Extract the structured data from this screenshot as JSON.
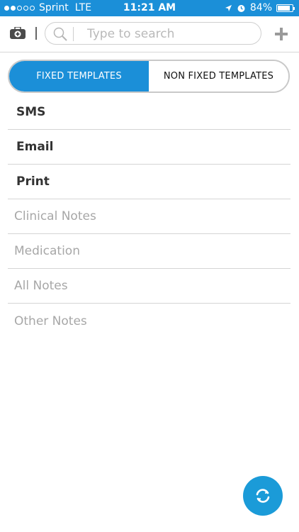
{
  "status_bar": {
    "carrier": "Sprint",
    "network": "LTE",
    "time": "11:21 AM",
    "battery": "84%"
  },
  "search": {
    "placeholder": "Type to search"
  },
  "tabs": [
    {
      "label": "FIXED TEMPLATES",
      "active": true
    },
    {
      "label": "NON FIXED TEMPLATES",
      "active": false
    }
  ],
  "items": [
    {
      "label": "SMS"
    },
    {
      "label": "Email"
    },
    {
      "label": "Print"
    },
    {
      "label": "Clinical Notes"
    },
    {
      "label": "Medication"
    },
    {
      "label": "All Notes"
    },
    {
      "label": "Other Notes"
    }
  ],
  "colors": {
    "accent": "#1b8fd8",
    "fab": "#1b9bd8",
    "text_dark": "#333333",
    "text_light": "#a7a7a7"
  },
  "icons": {
    "briefcase": "medical-briefcase-icon",
    "search": "search-icon",
    "add": "plus-icon",
    "refresh": "refresh-icon"
  }
}
